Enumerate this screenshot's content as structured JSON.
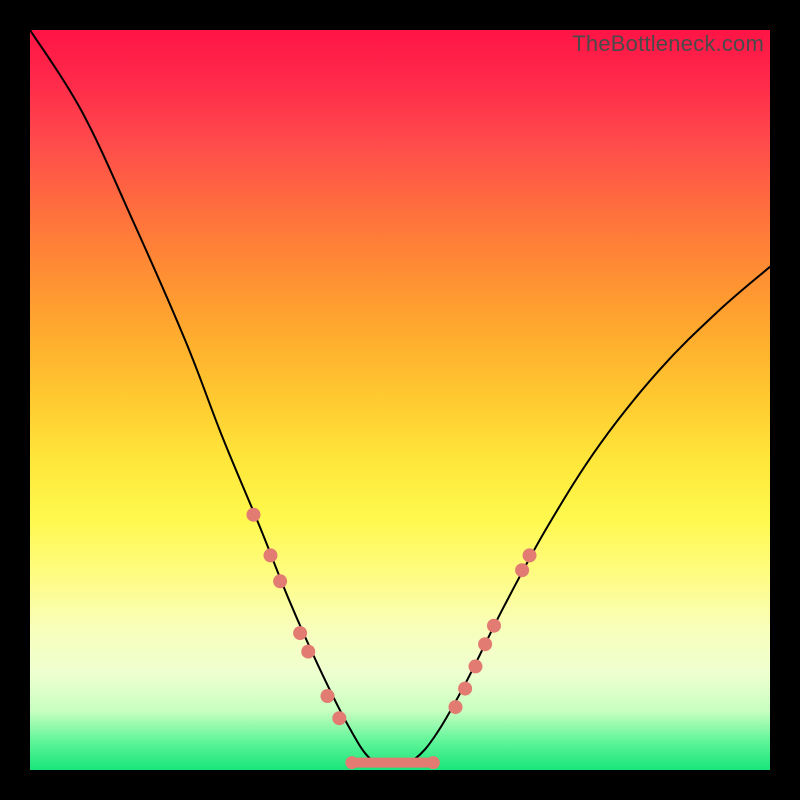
{
  "watermark": "TheBottleneck.com",
  "colors": {
    "dot": "#e27b72",
    "curve": "#000000"
  },
  "chart_data": {
    "type": "line",
    "title": "",
    "xlabel": "",
    "ylabel": "",
    "xlim": [
      0,
      100
    ],
    "ylim": [
      0,
      100
    ],
    "grid": false,
    "legend": false,
    "curve": [
      {
        "x": 0,
        "y": 100
      },
      {
        "x": 7,
        "y": 89
      },
      {
        "x": 14,
        "y": 74
      },
      {
        "x": 21,
        "y": 58
      },
      {
        "x": 26,
        "y": 45
      },
      {
        "x": 31,
        "y": 33
      },
      {
        "x": 35,
        "y": 23
      },
      {
        "x": 39,
        "y": 14
      },
      {
        "x": 43,
        "y": 6
      },
      {
        "x": 46,
        "y": 1.5
      },
      {
        "x": 49,
        "y": 0.5
      },
      {
        "x": 52,
        "y": 1.5
      },
      {
        "x": 55,
        "y": 5
      },
      {
        "x": 59,
        "y": 12
      },
      {
        "x": 64,
        "y": 22
      },
      {
        "x": 70,
        "y": 33
      },
      {
        "x": 77,
        "y": 44
      },
      {
        "x": 85,
        "y": 54
      },
      {
        "x": 93,
        "y": 62
      },
      {
        "x": 100,
        "y": 68
      }
    ],
    "markers_left": [
      {
        "x": 30.2,
        "y": 34.5
      },
      {
        "x": 32.5,
        "y": 29.0
      },
      {
        "x": 33.8,
        "y": 25.5
      },
      {
        "x": 36.5,
        "y": 18.5
      },
      {
        "x": 37.6,
        "y": 16.0
      },
      {
        "x": 40.2,
        "y": 10.0
      },
      {
        "x": 41.8,
        "y": 7.0
      }
    ],
    "markers_right": [
      {
        "x": 57.5,
        "y": 8.5
      },
      {
        "x": 58.8,
        "y": 11.0
      },
      {
        "x": 60.2,
        "y": 14.0
      },
      {
        "x": 61.5,
        "y": 17.0
      },
      {
        "x": 62.7,
        "y": 19.5
      },
      {
        "x": 66.5,
        "y": 27.0
      },
      {
        "x": 67.5,
        "y": 29.0
      }
    ],
    "bottom_segment": {
      "x0": 43.5,
      "x1": 54.5,
      "y": 1.0
    }
  }
}
